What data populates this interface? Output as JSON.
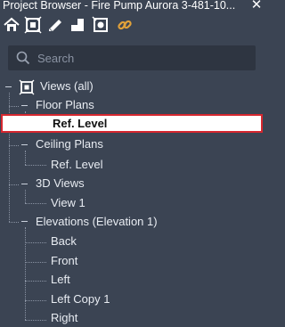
{
  "window": {
    "title": "Project Browser - Fire Pump Aurora 3-481-10...",
    "close_glyph": "✕"
  },
  "toolbar": {
    "buttons": [
      {
        "name": "home-icon"
      },
      {
        "name": "views-filter-icon"
      },
      {
        "name": "sheets-icon"
      },
      {
        "name": "families-icon"
      },
      {
        "name": "groups-icon"
      },
      {
        "name": "revit-links-icon"
      }
    ]
  },
  "search": {
    "placeholder": "Search",
    "value": ""
  },
  "tree": {
    "root": "Views (all)",
    "floor_plans": {
      "label": "Floor Plans",
      "items": [
        "Ref. Level"
      ],
      "selected": "Ref. Level"
    },
    "ceiling_plans": {
      "label": "Ceiling Plans",
      "items": [
        "Ref. Level"
      ]
    },
    "views_3d": {
      "label": "3D Views",
      "items": [
        "View 1"
      ]
    },
    "elevations": {
      "label": "Elevations (Elevation 1)",
      "items": [
        "Back",
        "Front",
        "Left",
        "Left Copy 1",
        "Right"
      ]
    }
  },
  "colors": {
    "background": "#3b4453",
    "selection_border": "#d6272f",
    "link_icon": "#e0a13a"
  }
}
